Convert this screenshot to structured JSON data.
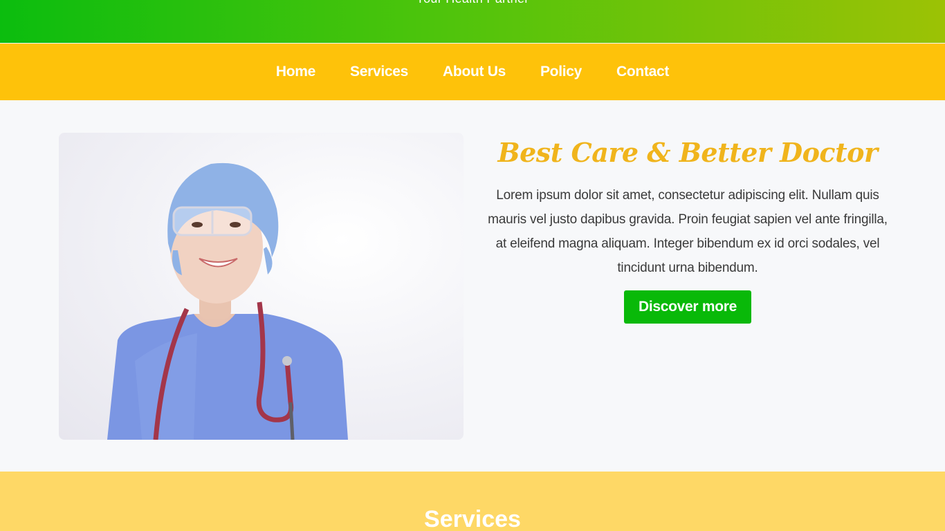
{
  "banner": {
    "tagline": "Your Health Partner"
  },
  "nav": {
    "items": [
      "Home",
      "Services",
      "About Us",
      "Policy",
      "Contact"
    ]
  },
  "hero": {
    "title": "Best Care & Better Doctor",
    "body": "Lorem ipsum dolor sit amet, consectetur adipiscing elit. Nullam quis mauris vel justo dapibus gravida. Proin feugiat sapien vel ante fringilla, at eleifend magna aliquam. Integer bibendum ex id orci sodales, vel tincidunt urna bibendum.",
    "button_label": "Discover more",
    "image_icon": "doctor-photo"
  },
  "services": {
    "heading": "Services"
  },
  "colors": {
    "banner_start": "#0bbd0e",
    "banner_end": "#9cc205",
    "nav_bg": "#fec20a",
    "title": "#f0b41c",
    "button": "#09b909",
    "services_bg": "#fed866"
  }
}
